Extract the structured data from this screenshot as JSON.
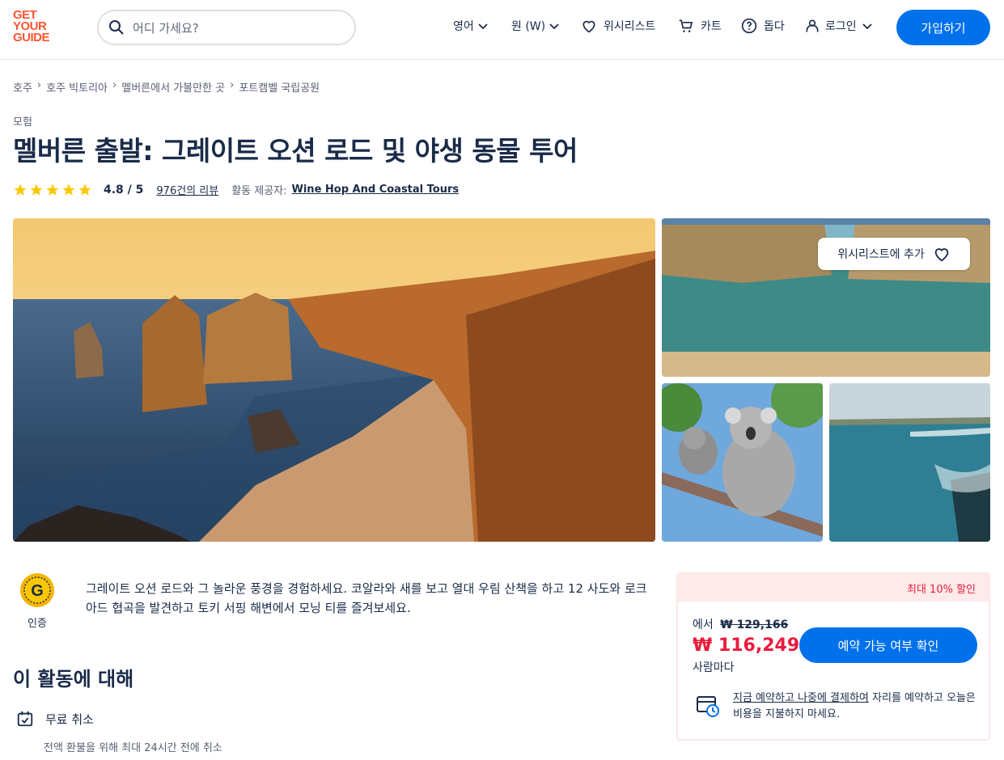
{
  "header": {
    "logo_lines": [
      "GET",
      "YOUR",
      "GUIDE"
    ],
    "search_placeholder": "어디 가세요?",
    "nav": {
      "language": "영어",
      "currency": "원 (W)",
      "wishlist": "위시리스트",
      "cart": "카트",
      "help": "돕다",
      "login": "로그인"
    },
    "signup": "가입하기"
  },
  "breadcrumbs": [
    "호주",
    "호주 빅토리아",
    "멜버른에서 가볼만한 곳",
    "포트캠벨 국립공원"
  ],
  "category": "모험",
  "title": "멜버른 출발: 그레이트 오션 로드 및 야생 동물 투어",
  "rating": {
    "score": "4.8 / 5",
    "stars": 5,
    "reviews": "976건의 리뷰",
    "provider_label": "활동 제공자:",
    "provider": "Wine Hop And Coastal Tours"
  },
  "gallery": {
    "wishlist_button": "위시리스트에 추가"
  },
  "badge": {
    "letter": "G",
    "label": "인증"
  },
  "description": "그레이트 오션 로드와 그 놀라운 풍경을 경험하세요. 코알라와 새를 보고 열대 우림 산책을 하고 12 사도와 로크 아드 협곡을 발견하고 토키 서핑 해변에서 모닝 티를 즐겨보세요.",
  "about": {
    "title": "이 활동에 대해",
    "feature_title": "무료 취소",
    "feature_sub": "전액 환불을 위해 최대 24시간 전에 취소"
  },
  "booking": {
    "discount": "최대 10% 할인",
    "from_label": "에서",
    "old_price": "₩ 129,166",
    "price": "₩ 116,249",
    "per_person": "사람마다",
    "check_button": "예약 가능 여부 확인",
    "reserve_link": "지금 예약하고 나중에 결제하여",
    "reserve_rest": " 자리를 예약하고 오늘은 비용을 지불하지 마세요."
  },
  "colors": {
    "brand": "#ff5533",
    "primary": "#0071eb",
    "price": "#eb1b3d",
    "star": "#fdc800"
  }
}
